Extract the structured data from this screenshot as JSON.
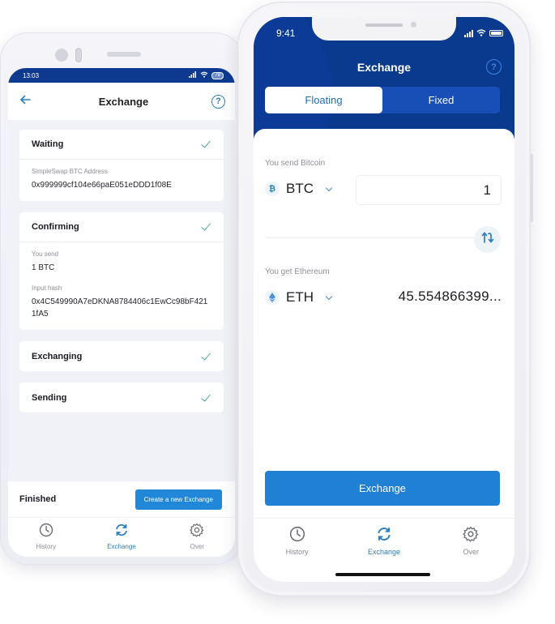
{
  "android": {
    "status": {
      "time": "13:03",
      "battery": "78"
    },
    "header": {
      "title": "Exchange",
      "back_icon": "arrow-left-icon",
      "help_icon": "question-circle-icon"
    },
    "steps": [
      {
        "title": "Waiting",
        "done": true,
        "fields": [
          {
            "label": "SimpleSwap BTC Address",
            "value": "0x999999cf104e66paE051eDDD1f08E"
          }
        ]
      },
      {
        "title": "Confirming",
        "done": true,
        "fields": [
          {
            "label": "You send",
            "value": "1 BTC"
          },
          {
            "label": "Input hash",
            "value": "0x4C549990A7eDKNA8784406c1EwCc98bF4211fA5"
          }
        ]
      },
      {
        "title": "Exchanging",
        "done": true,
        "fields": []
      },
      {
        "title": "Sending",
        "done": true,
        "fields": []
      }
    ],
    "finished": {
      "label": "Finished",
      "button": "Create a new Exchange"
    },
    "tabbar": [
      {
        "label": "History",
        "icon": "clock-icon",
        "active": false
      },
      {
        "label": "Exchange",
        "icon": "refresh-icon",
        "active": true
      },
      {
        "label": "Over",
        "icon": "gear-icon",
        "active": false
      }
    ]
  },
  "iphone": {
    "status": {
      "time": "9:41"
    },
    "header": {
      "title": "Exchange",
      "help_icon": "question-circle-icon"
    },
    "mode_tabs": [
      {
        "label": "Floating",
        "active": true
      },
      {
        "label": "Fixed",
        "active": false
      }
    ],
    "send": {
      "label": "You send Bitcoin",
      "coin": "BTC",
      "coin_icon": "bitcoin-icon",
      "amount": "1"
    },
    "get": {
      "label": "You get Ethereum",
      "coin": "ETH",
      "coin_icon": "ethereum-icon",
      "amount": "45.554866399..."
    },
    "exchange_button": "Exchange",
    "tabbar": [
      {
        "label": "History",
        "icon": "clock-icon",
        "active": false
      },
      {
        "label": "Exchange",
        "icon": "refresh-icon",
        "active": true
      },
      {
        "label": "Over",
        "icon": "gear-icon",
        "active": false
      }
    ],
    "colors": {
      "header_bg": "#0a3a8e",
      "accent": "#1f80d4",
      "check": "#4bab8e"
    }
  }
}
